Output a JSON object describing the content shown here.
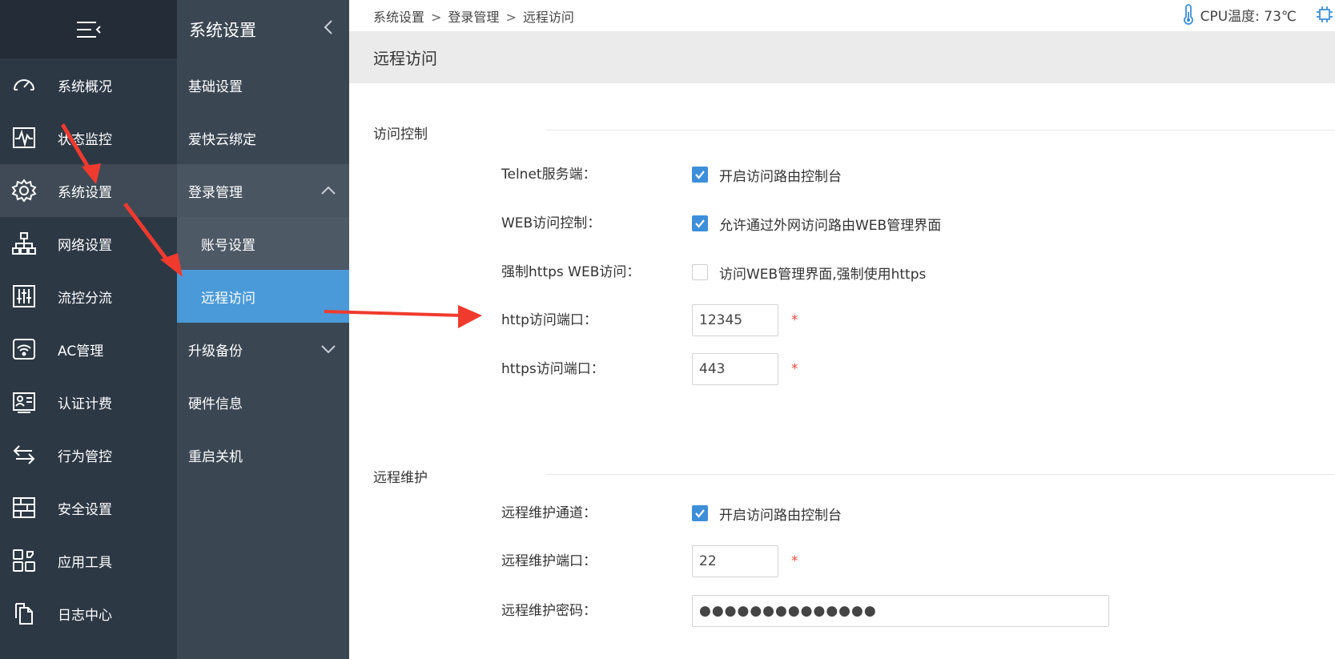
{
  "nav1": {
    "items": [
      {
        "label": "系统概况",
        "icon": "dashboard-icon"
      },
      {
        "label": "状态监控",
        "icon": "pulse-icon"
      },
      {
        "label": "系统设置",
        "icon": "gear-icon"
      },
      {
        "label": "网络设置",
        "icon": "network-icon"
      },
      {
        "label": "流控分流",
        "icon": "sliders-icon"
      },
      {
        "label": "AC管理",
        "icon": "wifi-icon"
      },
      {
        "label": "认证计费",
        "icon": "id-card-icon"
      },
      {
        "label": "行为管控",
        "icon": "swap-arrows-icon"
      },
      {
        "label": "安全设置",
        "icon": "firewall-icon"
      },
      {
        "label": "应用工具",
        "icon": "apps-icon"
      },
      {
        "label": "日志中心",
        "icon": "documents-icon"
      }
    ]
  },
  "nav2": {
    "title": "系统设置",
    "items": [
      {
        "label": "基础设置"
      },
      {
        "label": "爱快云绑定"
      },
      {
        "label": "登录管理"
      },
      {
        "label": "账号设置"
      },
      {
        "label": "远程访问"
      },
      {
        "label": "升级备份"
      },
      {
        "label": "硬件信息"
      },
      {
        "label": "重启关机"
      }
    ]
  },
  "breadcrumb": {
    "a": "系统设置",
    "b": "登录管理",
    "c": "远程访问",
    "sep": ">"
  },
  "cpu": {
    "label": "CPU温度: 73℃"
  },
  "page": {
    "title": "远程访问"
  },
  "access": {
    "title": "访问控制",
    "telnet": {
      "label": "Telnet服务端：",
      "option": "开启访问路由控制台",
      "checked": true
    },
    "web": {
      "label": "WEB访问控制：",
      "option": "允许通过外网访问路由WEB管理界面",
      "checked": true
    },
    "https": {
      "label": "强制https WEB访问：",
      "option": "访问WEB管理界面,强制使用https",
      "checked": false
    },
    "http_port": {
      "label": "http访问端口：",
      "value": "12345",
      "required": "*"
    },
    "https_port": {
      "label": "https访问端口：",
      "value": "443",
      "required": "*"
    }
  },
  "maint": {
    "title": "远程维护",
    "channel": {
      "label": "远程维护通道：",
      "option": "开启访问路由控制台",
      "checked": true
    },
    "port": {
      "label": "远程维护端口：",
      "value": "22",
      "required": "*"
    },
    "password": {
      "label": "远程维护密码：",
      "value": "●●●●●●●●●●●●●●"
    }
  },
  "colors": {
    "accent": "#4a9ad9",
    "checkbox": "#3d8fd9",
    "required": "#e64a3b",
    "arrow": "#f03a2e"
  }
}
